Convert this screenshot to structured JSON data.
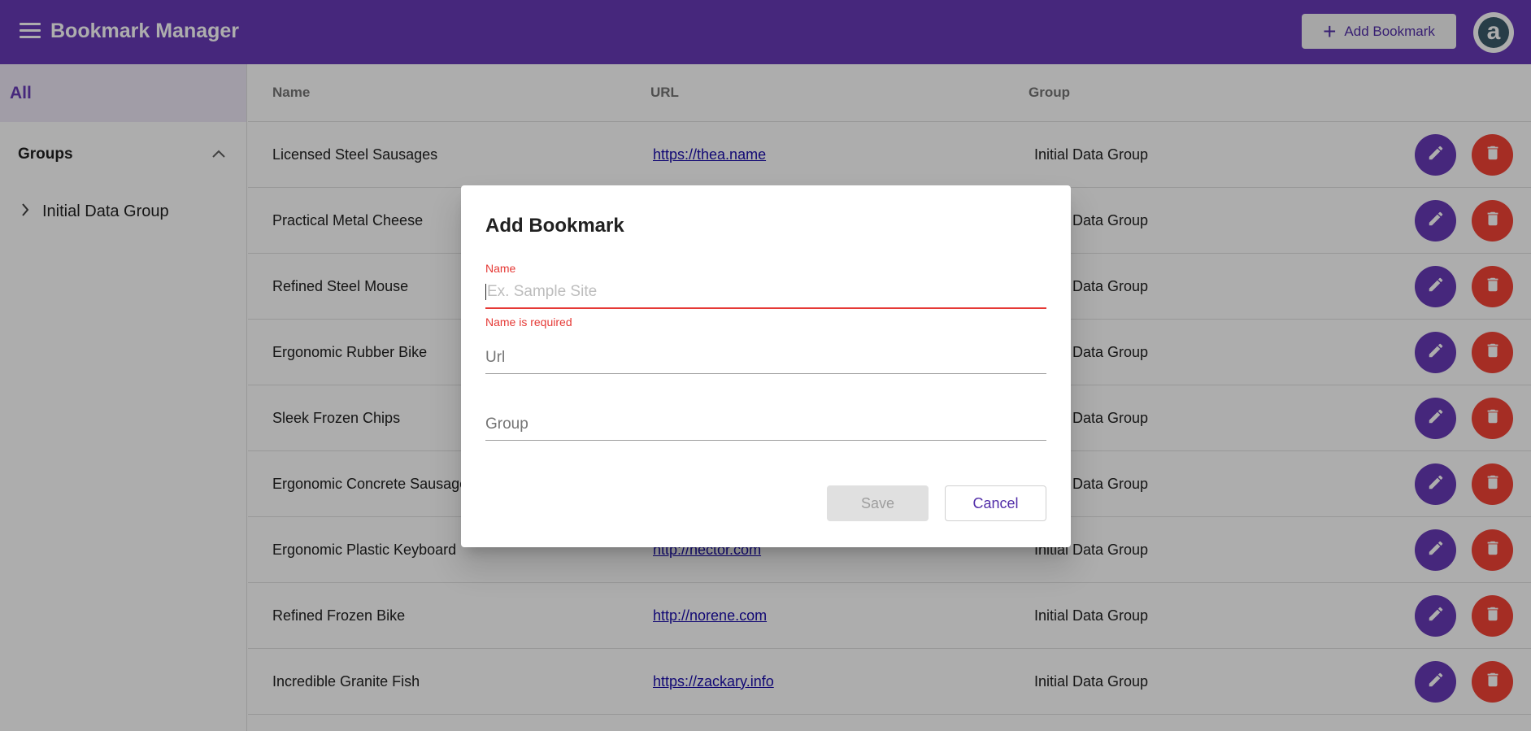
{
  "app": {
    "title": "Bookmark Manager"
  },
  "toolbar": {
    "add_label": "Add Bookmark"
  },
  "avatar": {
    "letter": "a"
  },
  "sidebar": {
    "all_label": "All",
    "groups_label": "Groups",
    "groups": [
      {
        "label": "Initial Data Group"
      }
    ]
  },
  "table": {
    "headers": {
      "name": "Name",
      "url": "URL",
      "group": "Group"
    },
    "rows": [
      {
        "name": "Licensed Steel Sausages",
        "url": "https://thea.name",
        "group": "Initial Data Group"
      },
      {
        "name": "Practical Metal Cheese",
        "url": "",
        "group": "Initial Data Group"
      },
      {
        "name": "Refined Steel Mouse",
        "url": "",
        "group": "Initial Data Group"
      },
      {
        "name": "Ergonomic Rubber Bike",
        "url": "",
        "group": "Initial Data Group"
      },
      {
        "name": "Sleek Frozen Chips",
        "url": "",
        "group": "Initial Data Group"
      },
      {
        "name": "Ergonomic Concrete Sausages",
        "url": "",
        "group": "Initial Data Group"
      },
      {
        "name": "Ergonomic Plastic Keyboard",
        "url": "http://hector.com",
        "group": "Initial Data Group"
      },
      {
        "name": "Refined Frozen Bike",
        "url": "http://norene.com",
        "group": "Initial Data Group"
      },
      {
        "name": "Incredible Granite Fish",
        "url": "https://zackary.info",
        "group": "Initial Data Group"
      }
    ]
  },
  "dialog": {
    "title": "Add Bookmark",
    "name_label": "Name",
    "name_placeholder": "Ex. Sample Site",
    "name_error": "Name is required",
    "url_placeholder": "Url",
    "group_placeholder": "Group",
    "save_label": "Save",
    "cancel_label": "Cancel"
  },
  "colors": {
    "primary": "#673ab7",
    "warn": "#f44336",
    "error": "#e53935"
  },
  "icons": {
    "edit": "pencil-icon",
    "delete": "trash-icon",
    "menu": "menu-icon",
    "add": "plus-icon"
  }
}
